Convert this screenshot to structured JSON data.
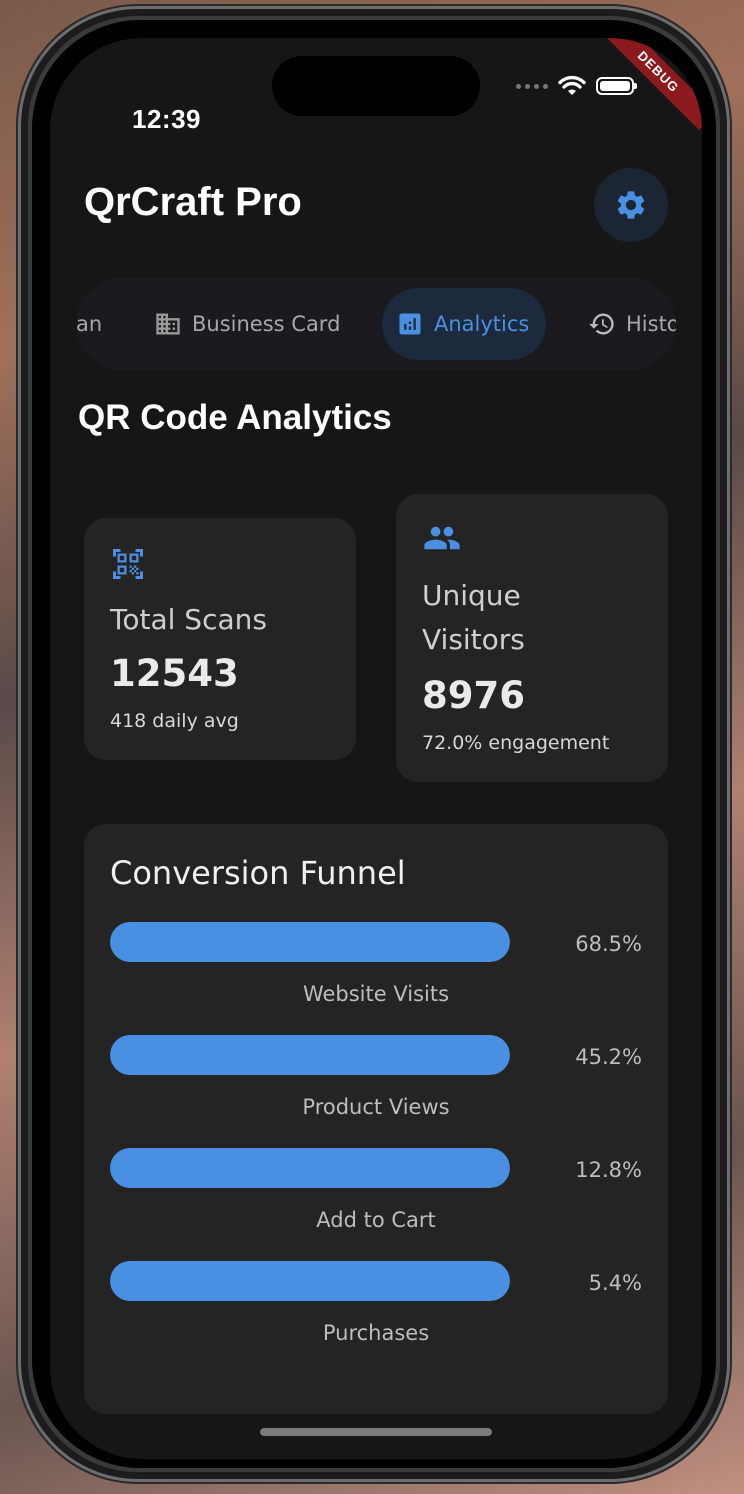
{
  "status_bar": {
    "time": "12:39",
    "debug_banner": "DEBUG"
  },
  "app_bar": {
    "title": "QrCraft Pro",
    "settings_icon": "gear-icon"
  },
  "tabs": [
    {
      "label": "an",
      "icon": "",
      "active": false
    },
    {
      "label": "Business Card",
      "icon": "building-icon",
      "active": false
    },
    {
      "label": "Analytics",
      "icon": "bar-chart-icon",
      "active": true
    },
    {
      "label": "Histo",
      "icon": "history-icon",
      "active": false
    }
  ],
  "page": {
    "title": "QR Code Analytics"
  },
  "stats": {
    "total_scans": {
      "icon": "qr-scan-icon",
      "label": "Total Scans",
      "value": "12543",
      "sub": "418 daily avg"
    },
    "unique_visitors": {
      "icon": "people-icon",
      "label_line1": "Unique",
      "label_line2": "Visitors",
      "value": "8976",
      "sub": "72.0% engagement"
    }
  },
  "funnel": {
    "title": "Conversion Funnel",
    "items": [
      {
        "label": "Website Visits",
        "percent_text": "68.5%",
        "fill": 1.0
      },
      {
        "label": "Product Views",
        "percent_text": "45.2%",
        "fill": 1.0
      },
      {
        "label": "Add to Cart",
        "percent_text": "12.8%",
        "fill": 1.0
      },
      {
        "label": "Purchases",
        "percent_text": "5.4%",
        "fill": 1.0
      }
    ]
  },
  "colors": {
    "accent": "#4a90e2",
    "background": "#161616",
    "card": "#242424"
  }
}
